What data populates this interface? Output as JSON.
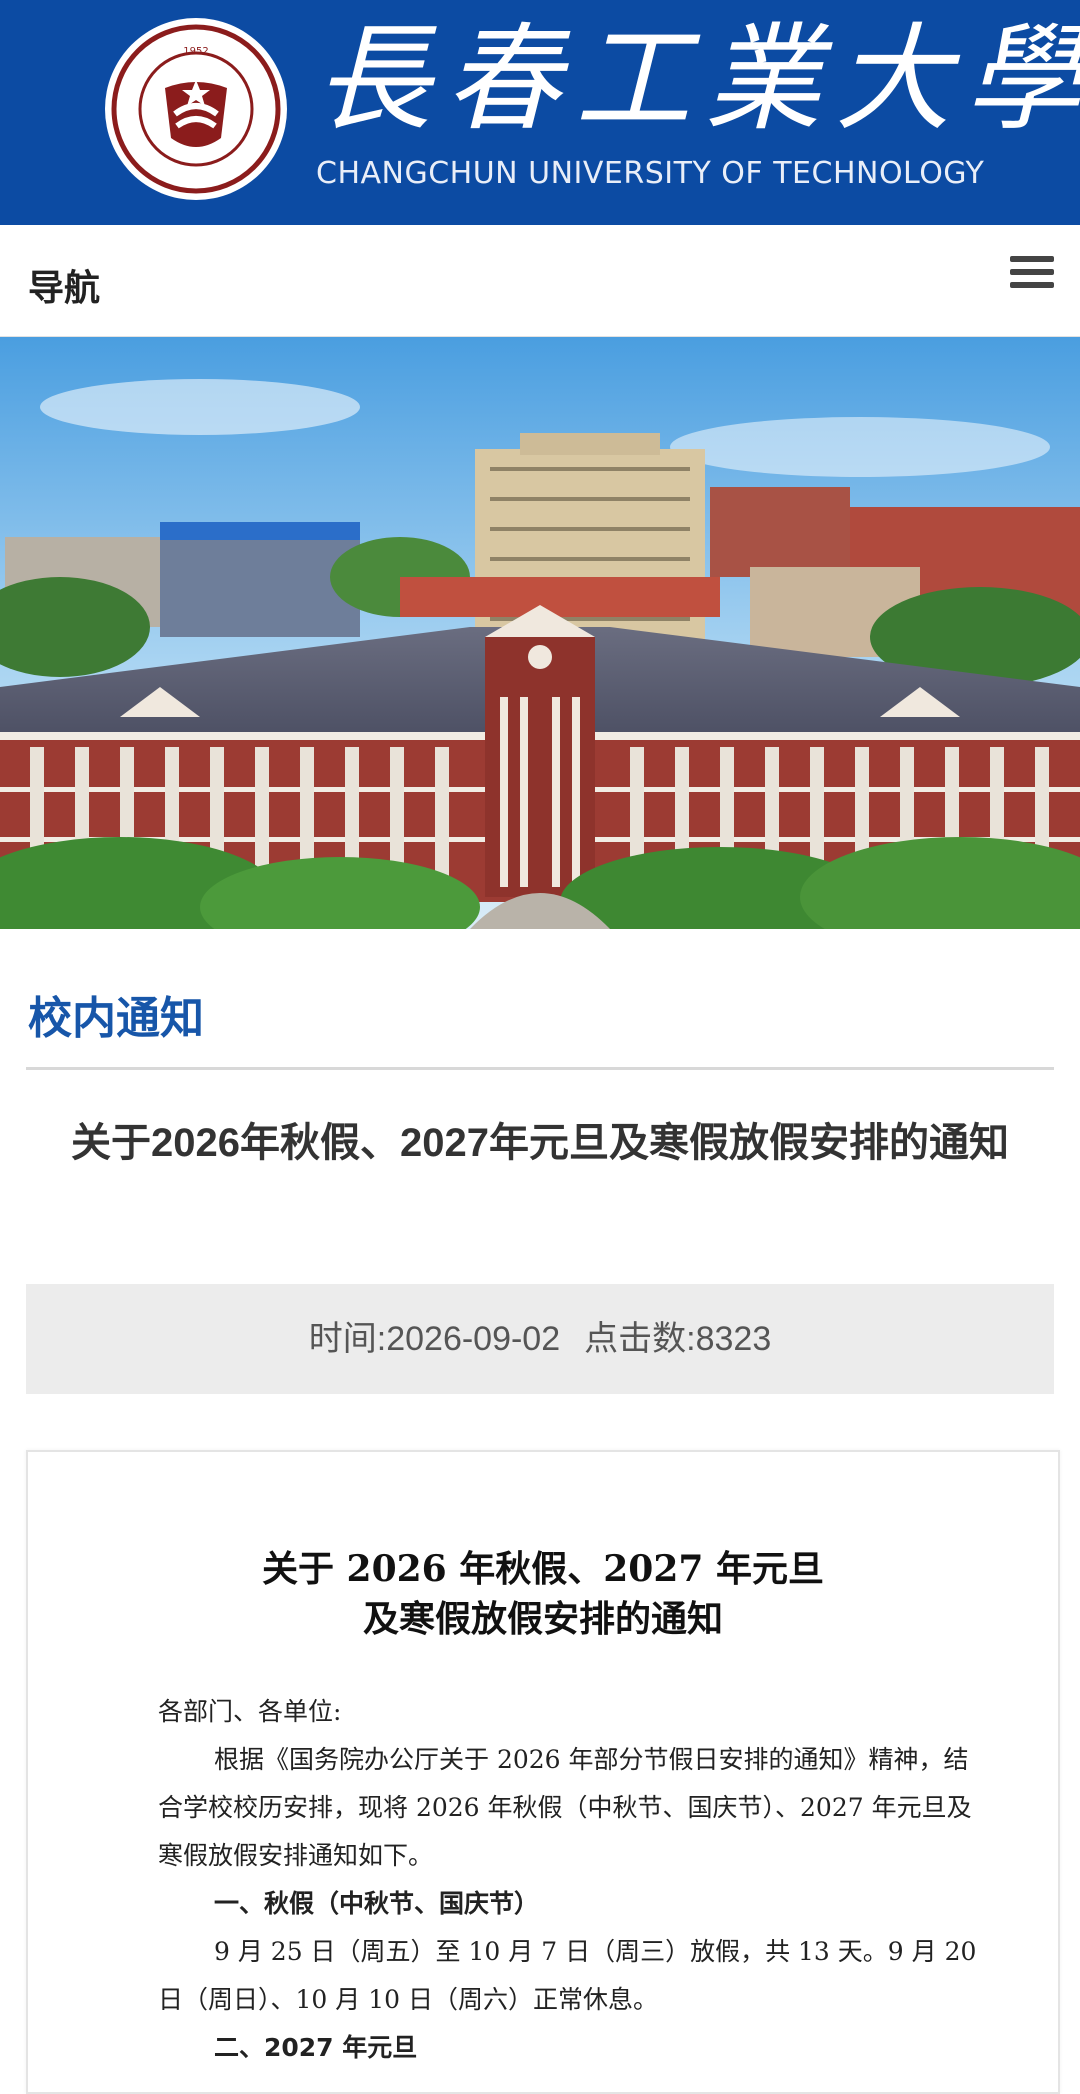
{
  "header": {
    "brand_cn": "長春工業大學",
    "brand_en": "CHANGCHUN UNIVERSITY OF TECHNOLOGY",
    "seal_ring_text": "CHANGCHUN UNIVERSITY OF TECHNOLOGY",
    "seal_year": "1952",
    "bg_color": "#0c4ba3"
  },
  "nav": {
    "label": "导航",
    "menu_icon": "hamburger-menu-icon"
  },
  "section": {
    "title": "校内通知",
    "accent": "#1756a9"
  },
  "article": {
    "title": "关于2026年秋假、2027年元旦及寒假放假安排的通知",
    "time": "时间:2026-09-02",
    "clicks": "点击数:8323"
  },
  "document": {
    "title_line1": "关于 2026 年秋假、2027 年元旦",
    "title_line2": "及寒假放假安排的通知",
    "salutation": "各部门、各单位:",
    "para1": "根据《国务院办公厅关于 2026 年部分节假日安排的通知》精神，结合学校校历安排，现将 2026 年秋假（中秋节、国庆节）、2027 年元旦及寒假放假安排通知如下。",
    "heading1": "一、秋假（中秋节、国庆节）",
    "para2": "9 月 25 日（周五）至 10 月 7 日（周三）放假，共 13 天。9 月 20 日（周日）、10 月 10 日（周六）正常休息。",
    "heading2": "二、2027 年元旦"
  }
}
